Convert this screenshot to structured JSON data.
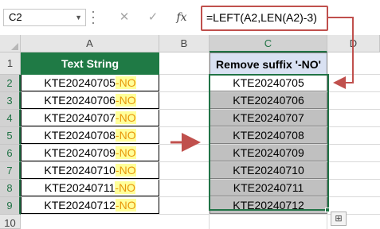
{
  "formula_bar": {
    "name_box": "C2",
    "cancel_icon": "x-icon",
    "enter_icon": "check-icon",
    "fx_label": "fx",
    "formula": "=LEFT(A2,LEN(A2)-3)"
  },
  "columns": [
    "A",
    "B",
    "C",
    "D"
  ],
  "rows": [
    "1",
    "2",
    "3",
    "4",
    "5",
    "6",
    "7",
    "8",
    "9",
    "10"
  ],
  "column_a": {
    "header": "Text String",
    "values": [
      {
        "base": "KTE20240705",
        "suffix": "-NO"
      },
      {
        "base": "KTE20240706",
        "suffix": "-NO"
      },
      {
        "base": "KTE20240707",
        "suffix": "-NO"
      },
      {
        "base": "KTE20240708",
        "suffix": "-NO"
      },
      {
        "base": "KTE20240709",
        "suffix": "-NO"
      },
      {
        "base": "KTE20240710",
        "suffix": "-NO"
      },
      {
        "base": "KTE20240711",
        "suffix": "-NO"
      },
      {
        "base": "KTE20240712",
        "suffix": "-NO"
      }
    ]
  },
  "column_c": {
    "header": "Remove suffix '-NO'",
    "values": [
      "KTE20240705",
      "KTE20240706",
      "KTE20240707",
      "KTE20240708",
      "KTE20240709",
      "KTE20240710",
      "KTE20240711",
      "KTE20240712"
    ]
  },
  "colors": {
    "header_green": "#1f7a45",
    "header_blue": "#d9e1f2",
    "suffix_highlight": "#ffff99",
    "suffix_text": "#e8960c",
    "result_gray": "#c0c0c0",
    "arrow_red": "#c0504d"
  }
}
